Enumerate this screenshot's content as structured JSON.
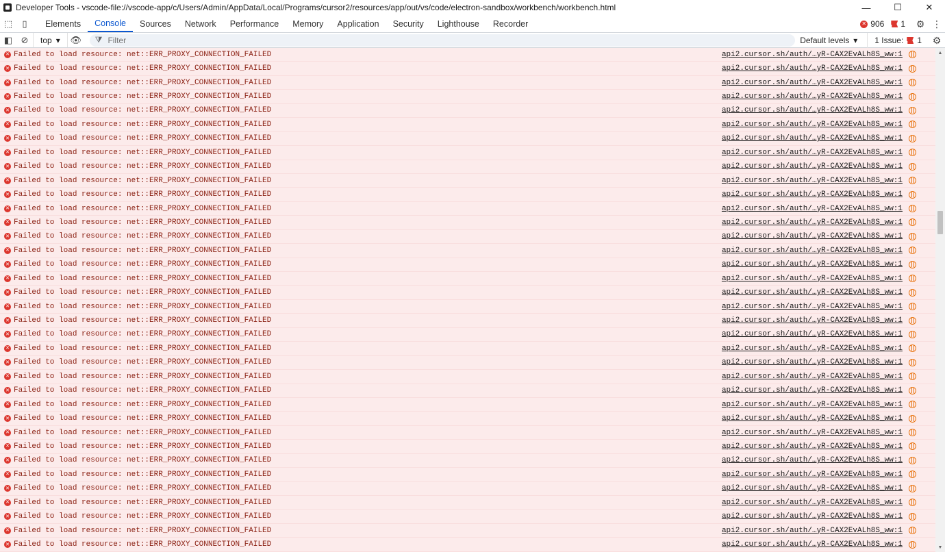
{
  "window": {
    "title": "Developer Tools - vscode-file://vscode-app/c/Users/Admin/AppData/Local/Programs/cursor2/resources/app/out/vs/code/electron-sandbox/workbench/workbench.html",
    "minimize": "—",
    "maximize": "☐",
    "close": "✕"
  },
  "tabs": [
    {
      "label": "Elements"
    },
    {
      "label": "Console",
      "active": true
    },
    {
      "label": "Sources"
    },
    {
      "label": "Network"
    },
    {
      "label": "Performance"
    },
    {
      "label": "Memory"
    },
    {
      "label": "Application"
    },
    {
      "label": "Security"
    },
    {
      "label": "Lighthouse"
    },
    {
      "label": "Recorder"
    }
  ],
  "status": {
    "error_count": "906",
    "issue_count": "1"
  },
  "console_toolbar": {
    "context": "top",
    "filter_placeholder": "Filter",
    "levels": "Default levels",
    "issues_label": "1 Issue:",
    "issues_count": "1"
  },
  "messages": [
    {
      "text": "Failed to load resource: net::ERR_PROXY_CONNECTION_FAILED",
      "source": "api2.cursor.sh/auth/…yR-CAX2EvALh8S_ww:1"
    },
    {
      "text": "Failed to load resource: net::ERR_PROXY_CONNECTION_FAILED",
      "source": "api2.cursor.sh/auth/…yR-CAX2EvALh8S_ww:1"
    },
    {
      "text": "Failed to load resource: net::ERR_PROXY_CONNECTION_FAILED",
      "source": "api2.cursor.sh/auth/…yR-CAX2EvALh8S_ww:1"
    },
    {
      "text": "Failed to load resource: net::ERR_PROXY_CONNECTION_FAILED",
      "source": "api2.cursor.sh/auth/…yR-CAX2EvALh8S_ww:1"
    },
    {
      "text": "Failed to load resource: net::ERR_PROXY_CONNECTION_FAILED",
      "source": "api2.cursor.sh/auth/…yR-CAX2EvALh8S_ww:1"
    },
    {
      "text": "Failed to load resource: net::ERR_PROXY_CONNECTION_FAILED",
      "source": "api2.cursor.sh/auth/…yR-CAX2EvALh8S_ww:1"
    },
    {
      "text": "Failed to load resource: net::ERR_PROXY_CONNECTION_FAILED",
      "source": "api2.cursor.sh/auth/…yR-CAX2EvALh8S_ww:1"
    },
    {
      "text": "Failed to load resource: net::ERR_PROXY_CONNECTION_FAILED",
      "source": "api2.cursor.sh/auth/…yR-CAX2EvALh8S_ww:1"
    },
    {
      "text": "Failed to load resource: net::ERR_PROXY_CONNECTION_FAILED",
      "source": "api2.cursor.sh/auth/…yR-CAX2EvALh8S_ww:1"
    },
    {
      "text": "Failed to load resource: net::ERR_PROXY_CONNECTION_FAILED",
      "source": "api2.cursor.sh/auth/…yR-CAX2EvALh8S_ww:1"
    },
    {
      "text": "Failed to load resource: net::ERR_PROXY_CONNECTION_FAILED",
      "source": "api2.cursor.sh/auth/…yR-CAX2EvALh8S_ww:1"
    },
    {
      "text": "Failed to load resource: net::ERR_PROXY_CONNECTION_FAILED",
      "source": "api2.cursor.sh/auth/…yR-CAX2EvALh8S_ww:1"
    },
    {
      "text": "Failed to load resource: net::ERR_PROXY_CONNECTION_FAILED",
      "source": "api2.cursor.sh/auth/…yR-CAX2EvALh8S_ww:1"
    },
    {
      "text": "Failed to load resource: net::ERR_PROXY_CONNECTION_FAILED",
      "source": "api2.cursor.sh/auth/…yR-CAX2EvALh8S_ww:1"
    },
    {
      "text": "Failed to load resource: net::ERR_PROXY_CONNECTION_FAILED",
      "source": "api2.cursor.sh/auth/…yR-CAX2EvALh8S_ww:1"
    },
    {
      "text": "Failed to load resource: net::ERR_PROXY_CONNECTION_FAILED",
      "source": "api2.cursor.sh/auth/…yR-CAX2EvALh8S_ww:1"
    },
    {
      "text": "Failed to load resource: net::ERR_PROXY_CONNECTION_FAILED",
      "source": "api2.cursor.sh/auth/…yR-CAX2EvALh8S_ww:1"
    },
    {
      "text": "Failed to load resource: net::ERR_PROXY_CONNECTION_FAILED",
      "source": "api2.cursor.sh/auth/…yR-CAX2EvALh8S_ww:1"
    },
    {
      "text": "Failed to load resource: net::ERR_PROXY_CONNECTION_FAILED",
      "source": "api2.cursor.sh/auth/…yR-CAX2EvALh8S_ww:1"
    },
    {
      "text": "Failed to load resource: net::ERR_PROXY_CONNECTION_FAILED",
      "source": "api2.cursor.sh/auth/…yR-CAX2EvALh8S_ww:1"
    },
    {
      "text": "Failed to load resource: net::ERR_PROXY_CONNECTION_FAILED",
      "source": "api2.cursor.sh/auth/…yR-CAX2EvALh8S_ww:1"
    },
    {
      "text": "Failed to load resource: net::ERR_PROXY_CONNECTION_FAILED",
      "source": "api2.cursor.sh/auth/…yR-CAX2EvALh8S_ww:1"
    },
    {
      "text": "Failed to load resource: net::ERR_PROXY_CONNECTION_FAILED",
      "source": "api2.cursor.sh/auth/…yR-CAX2EvALh8S_ww:1"
    },
    {
      "text": "Failed to load resource: net::ERR_PROXY_CONNECTION_FAILED",
      "source": "api2.cursor.sh/auth/…yR-CAX2EvALh8S_ww:1"
    },
    {
      "text": "Failed to load resource: net::ERR_PROXY_CONNECTION_FAILED",
      "source": "api2.cursor.sh/auth/…yR-CAX2EvALh8S_ww:1"
    },
    {
      "text": "Failed to load resource: net::ERR_PROXY_CONNECTION_FAILED",
      "source": "api2.cursor.sh/auth/…yR-CAX2EvALh8S_ww:1"
    },
    {
      "text": "Failed to load resource: net::ERR_PROXY_CONNECTION_FAILED",
      "source": "api2.cursor.sh/auth/…yR-CAX2EvALh8S_ww:1"
    },
    {
      "text": "Failed to load resource: net::ERR_PROXY_CONNECTION_FAILED",
      "source": "api2.cursor.sh/auth/…yR-CAX2EvALh8S_ww:1"
    },
    {
      "text": "Failed to load resource: net::ERR_PROXY_CONNECTION_FAILED",
      "source": "api2.cursor.sh/auth/…yR-CAX2EvALh8S_ww:1"
    },
    {
      "text": "Failed to load resource: net::ERR_PROXY_CONNECTION_FAILED",
      "source": "api2.cursor.sh/auth/…yR-CAX2EvALh8S_ww:1"
    },
    {
      "text": "Failed to load resource: net::ERR_PROXY_CONNECTION_FAILED",
      "source": "api2.cursor.sh/auth/…yR-CAX2EvALh8S_ww:1"
    },
    {
      "text": "Failed to load resource: net::ERR_PROXY_CONNECTION_FAILED",
      "source": "api2.cursor.sh/auth/…yR-CAX2EvALh8S_ww:1"
    },
    {
      "text": "Failed to load resource: net::ERR_PROXY_CONNECTION_FAILED",
      "source": "api2.cursor.sh/auth/…yR-CAX2EvALh8S_ww:1"
    },
    {
      "text": "Failed to load resource: net::ERR_PROXY_CONNECTION_FAILED",
      "source": "api2.cursor.sh/auth/…yR-CAX2EvALh8S_ww:1"
    },
    {
      "text": "Failed to load resource: net::ERR_PROXY_CONNECTION_FAILED",
      "source": "api2.cursor.sh/auth/…yR-CAX2EvALh8S_ww:1"
    },
    {
      "text": "Failed to load resource: net::ERR_PROXY_CONNECTION_FAILED",
      "source": "api2.cursor.sh/auth/…yR-CAX2EvALh8S_ww:1"
    }
  ],
  "colors": {
    "accent": "#0b57d0",
    "error": "#dc362e",
    "error_row_bg": "#fcebeb",
    "error_text": "#8a1f11"
  }
}
